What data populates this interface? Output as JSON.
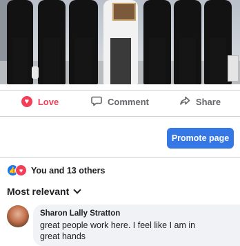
{
  "post": {
    "image_alt": "Group photo",
    "actions": {
      "love_label": "Love",
      "comment_label": "Comment",
      "share_label": "Share"
    },
    "promote_label": "Promote page",
    "reactions_text": "You and 13 others",
    "sort_label": "Most relevant"
  },
  "comment": {
    "author": "Sharon Lally Stratton",
    "text": "great people work here.  I feel like I am in great hands"
  },
  "colors": {
    "love": "#f33e58",
    "like": "#1877f2",
    "promote_bg": "#3578e5",
    "muted": "#65676b"
  }
}
